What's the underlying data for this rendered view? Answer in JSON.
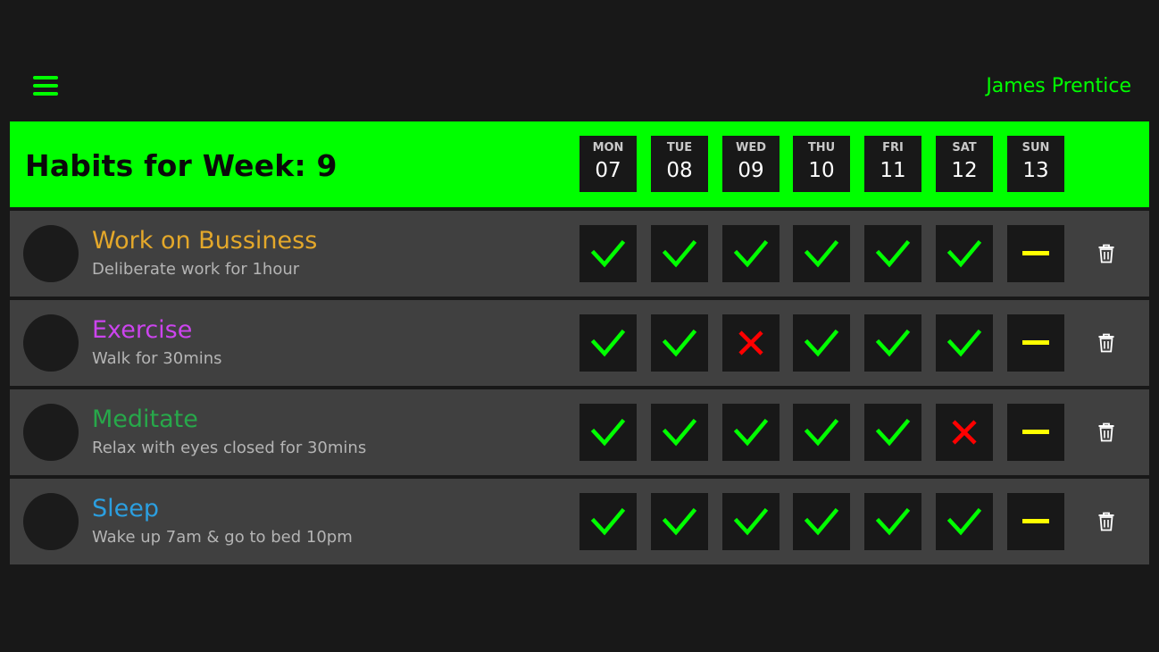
{
  "topbar": {
    "menu_icon": "hamburger-menu-icon",
    "user_name": "James Prentice"
  },
  "header": {
    "title": "Habits for Week: 9",
    "days": [
      {
        "name": "MON",
        "num": "07"
      },
      {
        "name": "TUE",
        "num": "08"
      },
      {
        "name": "WED",
        "num": "09"
      },
      {
        "name": "THU",
        "num": "10"
      },
      {
        "name": "FRI",
        "num": "11"
      },
      {
        "name": "SAT",
        "num": "12"
      },
      {
        "name": "SUN",
        "num": "13"
      }
    ]
  },
  "colors": {
    "accent": "#00ff00",
    "done": "#00ff00",
    "missed": "#ff0000",
    "pending": "#ffff00"
  },
  "habits": [
    {
      "name": "Work on Bussiness",
      "description": "Deliberate work for 1hour",
      "color": "#e4a82a",
      "statuses": [
        "done",
        "done",
        "done",
        "done",
        "done",
        "done",
        "pending"
      ]
    },
    {
      "name": "Exercise",
      "description": "Walk for 30mins",
      "color": "#cc44ee",
      "statuses": [
        "done",
        "done",
        "missed",
        "done",
        "done",
        "done",
        "pending"
      ]
    },
    {
      "name": "Meditate",
      "description": "Relax with eyes closed for 30mins",
      "color": "#27a84a",
      "statuses": [
        "done",
        "done",
        "done",
        "done",
        "done",
        "missed",
        "pending"
      ]
    },
    {
      "name": "Sleep",
      "description": "Wake up 7am & go to bed 10pm",
      "color": "#2b9fe0",
      "statuses": [
        "done",
        "done",
        "done",
        "done",
        "done",
        "done",
        "pending"
      ]
    }
  ],
  "icons": {
    "done": "checkmark-icon",
    "missed": "cross-icon",
    "pending": "dash-icon",
    "delete": "trash-icon"
  }
}
